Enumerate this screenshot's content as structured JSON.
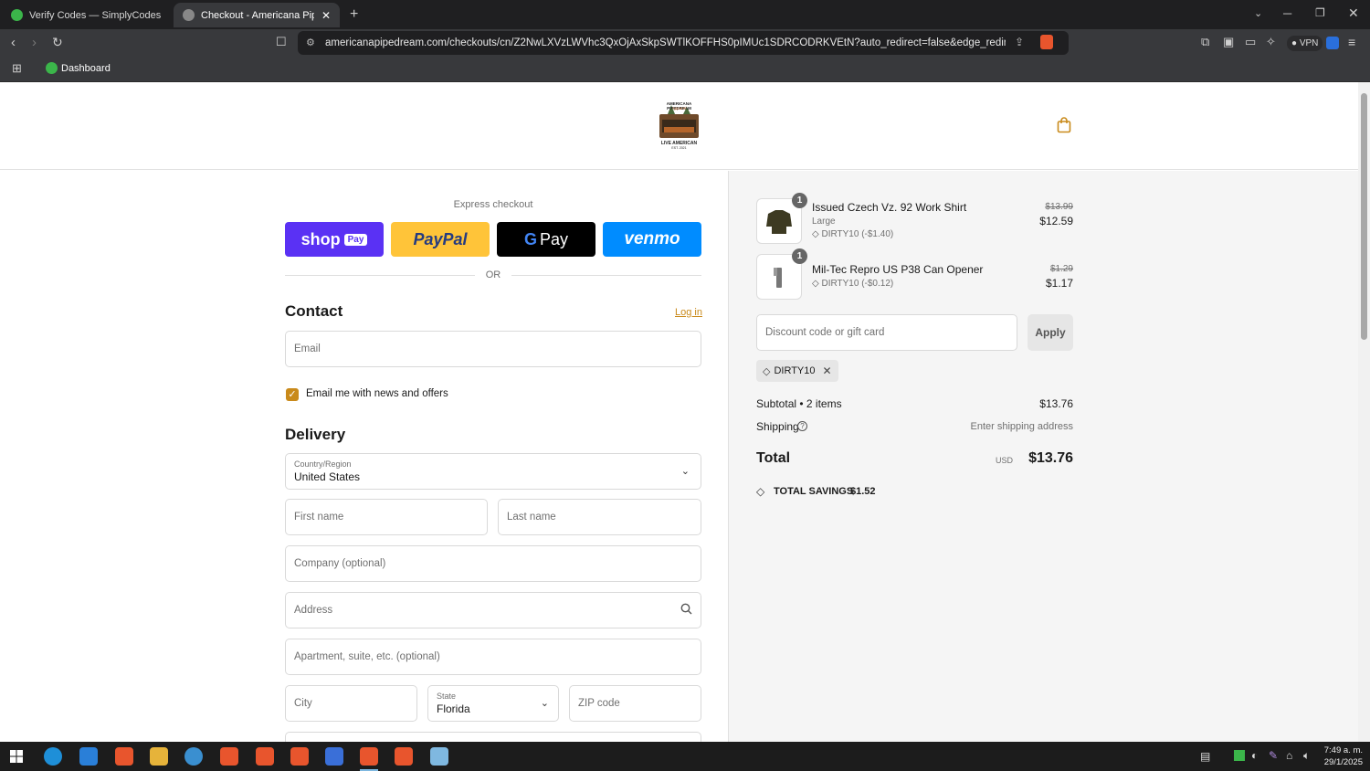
{
  "browser": {
    "tabs": [
      {
        "title": "Verify Codes — SimplyCodes",
        "active": false
      },
      {
        "title": "Checkout - Americana Pipedre",
        "active": true
      }
    ],
    "url": "americanapipedream.com/checkouts/cn/Z2NwLXVzLWVhc3QxOjAxSkpSWTlKOFFHS0pIMUc1SDRCODRKVEtN?auto_redirect=false&edge_redirect=true&...",
    "vpn_label": "VPN",
    "bookmark": "Dashboard"
  },
  "store": {
    "logo_top": "AMERICANA PIPEDREAM",
    "logo_mid": "Apparel",
    "logo_bottom": "LIVE AMERICAN",
    "logo_est": "EST. 2021"
  },
  "express": {
    "title": "Express checkout",
    "shop_label": "shop",
    "shop_pay_label": "Pay",
    "paypal_label": "PayPal",
    "gpay_label": "Pay",
    "venmo_label": "venmo",
    "or_label": "OR"
  },
  "contact": {
    "title": "Contact",
    "login_label": "Log in",
    "email_placeholder": "Email",
    "news_label": "Email me with news and offers",
    "news_checked": true
  },
  "delivery": {
    "title": "Delivery",
    "country_label": "Country/Region",
    "country_value": "United States",
    "first_name": "First name",
    "last_name": "Last name",
    "company": "Company (optional)",
    "address": "Address",
    "apartment": "Apartment, suite, etc. (optional)",
    "city": "City",
    "state_label": "State",
    "state_value": "Florida",
    "zip": "ZIP code"
  },
  "cart": {
    "items": [
      {
        "qty": "1",
        "name": "Issued Czech Vz. 92 Work Shirt",
        "variant": "Large",
        "discount": "DIRTY10 (-$1.40)",
        "original": "$13.99",
        "price": "$12.59"
      },
      {
        "qty": "1",
        "name": "Mil-Tec Repro US P38 Can Opener",
        "variant": "",
        "discount": "DIRTY10 (-$0.12)",
        "original": "$1.29",
        "price": "$1.17"
      }
    ],
    "discount_placeholder": "Discount code or gift card",
    "apply_label": "Apply",
    "applied_code": "DIRTY10",
    "subtotal_label": "Subtotal • 2 items",
    "subtotal_value": "$13.76",
    "shipping_label": "Shipping",
    "shipping_value": "Enter shipping address",
    "total_label": "Total",
    "currency": "USD",
    "total_value": "$13.76",
    "savings_label": "TOTAL SAVINGS",
    "savings_value": "$1.52"
  },
  "taskbar": {
    "time": "7:49 a. m.",
    "date": "29/1/2025"
  },
  "colors": {
    "accent": "#c98a1b",
    "shop": "#5a31f4",
    "paypal": "#ffc439",
    "venmo": "#008cff"
  }
}
